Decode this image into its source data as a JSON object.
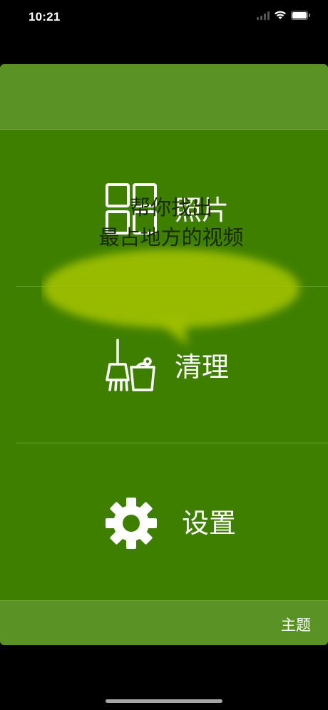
{
  "status_bar": {
    "time": "10:21",
    "icons": [
      "signal-icon",
      "wifi-icon",
      "battery-icon"
    ]
  },
  "menu": {
    "photos_label": "照片",
    "clean_label": "清理",
    "settings_label": "设置"
  },
  "tooltip": {
    "line1": "帮你找出",
    "line2": "最占地方的视频"
  },
  "footer": {
    "theme_label": "主题"
  },
  "colors": {
    "background": "#000000",
    "card": "#3f7f00",
    "header_footer": "#5b9225",
    "bubble": "#9fc000",
    "text": "#ffffff"
  }
}
